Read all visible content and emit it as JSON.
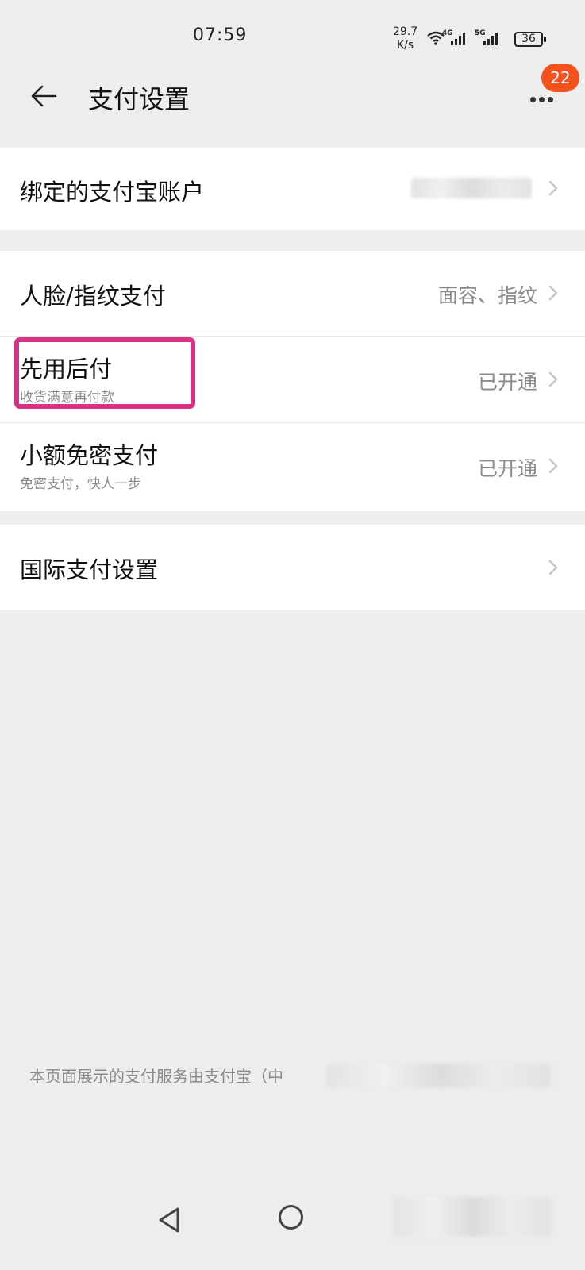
{
  "status_bar": {
    "time": "07:59",
    "net_speed_value": "29.7",
    "net_speed_unit": "K/s",
    "sim1_label": "4G",
    "sim2_label": "5G",
    "battery": "36",
    "icons": [
      "wifi-icon",
      "signal-icon",
      "signal-icon",
      "battery-icon"
    ]
  },
  "header": {
    "title": "支付设置",
    "badge_count": "22",
    "icons": [
      "back-arrow-icon",
      "more-icon"
    ]
  },
  "sections": {
    "bound_account": {
      "title": "绑定的支付宝账户"
    },
    "face_fingerprint": {
      "title": "人脸/指纹支付",
      "value": "面容、指纹"
    },
    "pay_later": {
      "title": "先用后付",
      "subtitle": "收货满意再付款",
      "value": "已开通"
    },
    "small_amount": {
      "title": "小额免密支付",
      "subtitle": "免密支付，快人一步",
      "value": "已开通"
    },
    "international": {
      "title": "国际支付设置"
    }
  },
  "footer": {
    "note": "本页面展示的支付服务由支付宝（中"
  },
  "colors": {
    "background": "#ededed",
    "card": "#ffffff",
    "highlight": "#d63384",
    "badge": "#f4511e",
    "secondary_text": "#8a8a8a"
  }
}
